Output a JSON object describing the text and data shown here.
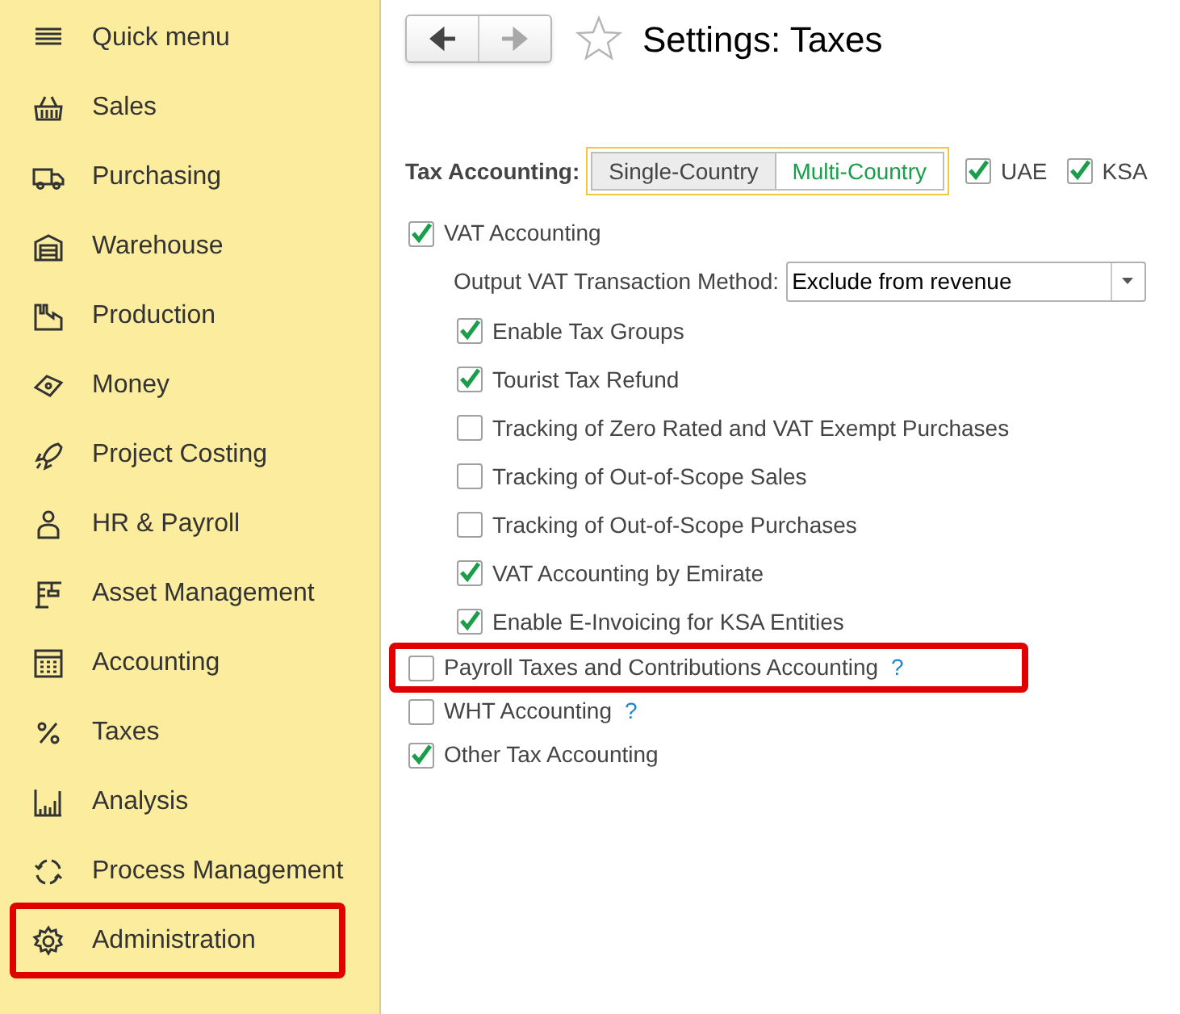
{
  "sidebar": {
    "items": [
      {
        "label": "Quick menu",
        "highlighted": false
      },
      {
        "label": "Sales",
        "highlighted": false
      },
      {
        "label": "Purchasing",
        "highlighted": false
      },
      {
        "label": "Warehouse",
        "highlighted": false
      },
      {
        "label": "Production",
        "highlighted": false
      },
      {
        "label": "Money",
        "highlighted": false
      },
      {
        "label": "Project Costing",
        "highlighted": false
      },
      {
        "label": "HR & Payroll",
        "highlighted": false
      },
      {
        "label": "Asset Management",
        "highlighted": false
      },
      {
        "label": "Accounting",
        "highlighted": false
      },
      {
        "label": "Taxes",
        "highlighted": false
      },
      {
        "label": "Analysis",
        "highlighted": false
      },
      {
        "label": "Process Management",
        "highlighted": false
      },
      {
        "label": "Administration",
        "highlighted": true
      }
    ]
  },
  "toolbar": {
    "back_disabled": false,
    "forward_disabled": true,
    "title": "Settings: Taxes"
  },
  "tax_accounting": {
    "label": "Tax Accounting:",
    "modes": [
      {
        "label": "Single-Country",
        "selected": false
      },
      {
        "label": "Multi-Country",
        "selected": true
      }
    ],
    "countries": [
      {
        "label": "UAE",
        "checked": true
      },
      {
        "label": "KSA",
        "checked": true
      }
    ]
  },
  "settings": [
    {
      "kind": "checkbox",
      "label": "VAT Accounting",
      "checked": true,
      "highlighted": false,
      "children": [
        {
          "kind": "select",
          "label": "Output VAT Transaction Method:",
          "value": "Exclude from revenue"
        },
        {
          "kind": "checkbox",
          "label": "Enable Tax Groups",
          "checked": true,
          "highlighted": false
        },
        {
          "kind": "checkbox",
          "label": "Tourist Tax Refund",
          "checked": true,
          "highlighted": false
        },
        {
          "kind": "checkbox",
          "label": "Tracking of Zero Rated and VAT Exempt Purchases",
          "checked": false,
          "highlighted": false
        },
        {
          "kind": "checkbox",
          "label": "Tracking of Out-of-Scope Sales",
          "checked": false,
          "highlighted": false
        },
        {
          "kind": "checkbox",
          "label": "Tracking of Out-of-Scope Purchases",
          "checked": false,
          "highlighted": false
        },
        {
          "kind": "checkbox",
          "label": "VAT Accounting by Emirate",
          "checked": true,
          "highlighted": false
        },
        {
          "kind": "checkbox",
          "label": "Enable E-Invoicing for KSA Entities",
          "checked": true,
          "highlighted": false
        }
      ]
    },
    {
      "kind": "checkbox",
      "label": "Payroll Taxes and Contributions Accounting",
      "checked": false,
      "highlighted": true,
      "help": "?"
    },
    {
      "kind": "checkbox",
      "label": "WHT Accounting",
      "checked": false,
      "highlighted": false,
      "help": "?"
    },
    {
      "kind": "checkbox",
      "label": "Other Tax Accounting",
      "checked": true,
      "highlighted": false
    }
  ]
}
